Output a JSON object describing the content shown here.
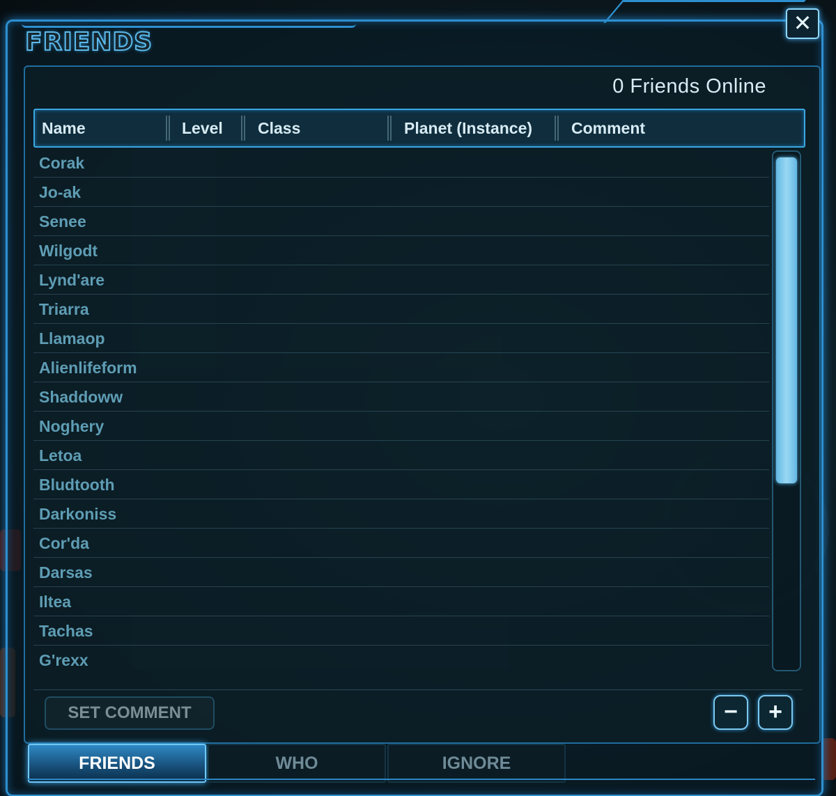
{
  "window": {
    "title": "FRIENDS",
    "close_label": "✕",
    "online_status": "0 Friends Online"
  },
  "table": {
    "columns": [
      "Name",
      "Level",
      "Class",
      "Planet (Instance)",
      "Comment"
    ],
    "rows": [
      "Corak",
      "Jo-ak",
      "Senee",
      "Wilgodt",
      "Lynd'are",
      "Triarra",
      "Llamaop",
      "Alienlifeform",
      "Shaddoww",
      "Noghery",
      "Letoa",
      "Bludtooth",
      "Darkoniss",
      "Cor'da",
      "Darsas",
      "Iltea",
      "Tachas",
      "G'rexx"
    ]
  },
  "footer": {
    "set_comment_label": "SET COMMENT",
    "remove_label": "−",
    "add_label": "+"
  },
  "tabs": [
    {
      "label": "FRIENDS",
      "active": true
    },
    {
      "label": "WHO",
      "active": false
    },
    {
      "label": "IGNORE",
      "active": false
    }
  ],
  "colors": {
    "accent": "#2d8fcf",
    "name_text": "#5e9db4",
    "header_text": "#d7ebf4"
  }
}
